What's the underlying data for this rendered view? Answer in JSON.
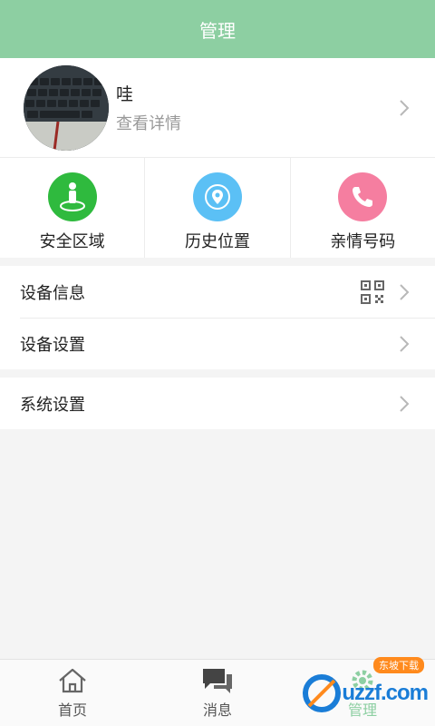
{
  "header": {
    "title": "管理"
  },
  "profile": {
    "name": "哇",
    "detail": "查看详情"
  },
  "quick_actions": [
    {
      "label": "安全区域",
      "icon": "person-pin-icon",
      "color": "#2fba3e"
    },
    {
      "label": "历史位置",
      "icon": "location-pin-icon",
      "color": "#5bc0f5"
    },
    {
      "label": "亲情号码",
      "icon": "phone-icon",
      "color": "#f57ea0"
    }
  ],
  "device_group": [
    {
      "label": "设备信息",
      "icon": "qr-code-icon"
    },
    {
      "label": "设备设置"
    }
  ],
  "system_group": [
    {
      "label": "系统设置"
    }
  ],
  "tabbar": [
    {
      "label": "首页",
      "icon": "home-icon"
    },
    {
      "label": "消息",
      "icon": "chat-icon"
    },
    {
      "label": "管理",
      "icon": "gear-icon",
      "active": true
    }
  ],
  "watermark": {
    "text": "uzzf.com",
    "badge": "东坡下载"
  },
  "colors": {
    "accent": "#8dcfa2"
  }
}
